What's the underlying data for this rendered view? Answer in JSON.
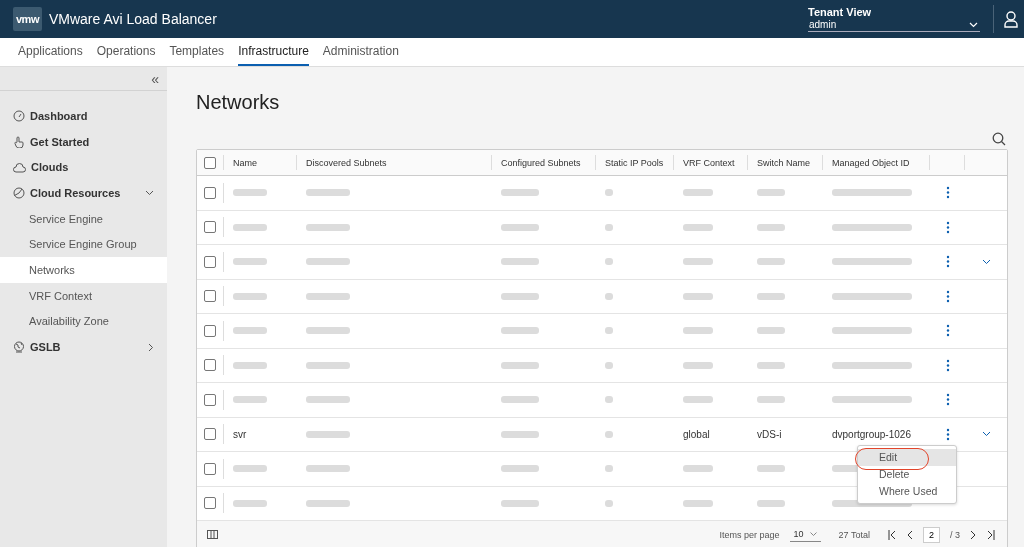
{
  "header": {
    "logo": "vmw",
    "title": "VMware Avi Load Balancer",
    "tenant_label": "Tenant View",
    "tenant_value": "admin"
  },
  "nav_tabs": [
    {
      "label": "Applications",
      "selected": false
    },
    {
      "label": "Operations",
      "selected": false
    },
    {
      "label": "Templates",
      "selected": false
    },
    {
      "label": "Infrastructure",
      "selected": true
    },
    {
      "label": "Administration",
      "selected": false
    }
  ],
  "sidebar": {
    "collapse": "«",
    "items": [
      {
        "label": "Dashboard",
        "selected": false
      },
      {
        "label": "Get Started",
        "selected": false
      },
      {
        "label": "Clouds",
        "selected": false
      },
      {
        "label": "Cloud Resources",
        "selected": false,
        "expanded": true,
        "children": [
          {
            "label": "Service Engine",
            "selected": false
          },
          {
            "label": "Service Engine Group",
            "selected": false
          },
          {
            "label": "Networks",
            "selected": true
          },
          {
            "label": "VRF Context",
            "selected": false
          },
          {
            "label": "Availability Zone",
            "selected": false
          }
        ]
      },
      {
        "label": "GSLB",
        "selected": false,
        "expanded": false
      }
    ]
  },
  "page_title": "Networks",
  "table": {
    "select_all_checked": false,
    "columns": [
      "Name",
      "Discovered Subnets",
      "Configured Subnets",
      "Static IP Pools",
      "VRF Context",
      "Switch Name",
      "Managed Object ID"
    ],
    "rows": [
      {
        "checked": false,
        "expandable": false,
        "cells": [
          {
            "kind": "redacted"
          },
          {
            "kind": "redacted"
          },
          {
            "kind": "redacted"
          },
          {
            "kind": "redacted"
          },
          {
            "kind": "redacted"
          },
          {
            "kind": "redacted"
          },
          {
            "kind": "redacted"
          }
        ]
      },
      {
        "checked": false,
        "expandable": false,
        "cells": [
          {
            "kind": "redacted"
          },
          {
            "kind": "redacted"
          },
          {
            "kind": "redacted"
          },
          {
            "kind": "redacted"
          },
          {
            "kind": "redacted"
          },
          {
            "kind": "redacted"
          },
          {
            "kind": "redacted"
          }
        ]
      },
      {
        "checked": false,
        "expandable": true,
        "cells": [
          {
            "kind": "redacted"
          },
          {
            "kind": "redacted"
          },
          {
            "kind": "redacted"
          },
          {
            "kind": "redacted"
          },
          {
            "kind": "redacted"
          },
          {
            "kind": "redacted"
          },
          {
            "kind": "redacted"
          }
        ]
      },
      {
        "checked": false,
        "expandable": false,
        "cells": [
          {
            "kind": "redacted"
          },
          {
            "kind": "redacted"
          },
          {
            "kind": "redacted"
          },
          {
            "kind": "redacted"
          },
          {
            "kind": "redacted"
          },
          {
            "kind": "redacted"
          },
          {
            "kind": "redacted"
          }
        ]
      },
      {
        "checked": false,
        "expandable": false,
        "cells": [
          {
            "kind": "redacted"
          },
          {
            "kind": "redacted"
          },
          {
            "kind": "redacted"
          },
          {
            "kind": "redacted"
          },
          {
            "kind": "redacted"
          },
          {
            "kind": "redacted"
          },
          {
            "kind": "redacted"
          }
        ]
      },
      {
        "checked": false,
        "expandable": false,
        "cells": [
          {
            "kind": "redacted"
          },
          {
            "kind": "redacted"
          },
          {
            "kind": "redacted"
          },
          {
            "kind": "redacted"
          },
          {
            "kind": "redacted"
          },
          {
            "kind": "redacted"
          },
          {
            "kind": "redacted"
          }
        ]
      },
      {
        "checked": false,
        "expandable": false,
        "cells": [
          {
            "kind": "redacted"
          },
          {
            "kind": "redacted"
          },
          {
            "kind": "redacted"
          },
          {
            "kind": "redacted"
          },
          {
            "kind": "redacted"
          },
          {
            "kind": "redacted"
          },
          {
            "kind": "redacted"
          }
        ]
      },
      {
        "checked": false,
        "expandable": true,
        "menu": [
          {
            "label": "Edit",
            "highlighted": true,
            "circled": true
          },
          {
            "label": "Delete",
            "highlighted": false,
            "circled": false
          },
          {
            "label": "Where Used",
            "highlighted": false,
            "circled": false
          }
        ],
        "cells": [
          {
            "kind": "text",
            "text": "svr"
          },
          {
            "kind": "redacted"
          },
          {
            "kind": "redacted"
          },
          {
            "kind": "redacted"
          },
          {
            "kind": "text",
            "text": "global"
          },
          {
            "kind": "text",
            "text": "vDS-i"
          },
          {
            "kind": "text",
            "text": "dvportgroup-1026"
          }
        ]
      },
      {
        "checked": false,
        "expandable": false,
        "cells": [
          {
            "kind": "redacted"
          },
          {
            "kind": "redacted"
          },
          {
            "kind": "redacted"
          },
          {
            "kind": "redacted"
          },
          {
            "kind": "redacted"
          },
          {
            "kind": "redacted"
          },
          {
            "kind": "redacted"
          }
        ]
      },
      {
        "checked": false,
        "expandable": false,
        "cells": [
          {
            "kind": "redacted"
          },
          {
            "kind": "redacted"
          },
          {
            "kind": "redacted"
          },
          {
            "kind": "redacted"
          },
          {
            "kind": "redacted"
          },
          {
            "kind": "redacted"
          },
          {
            "kind": "redacted"
          }
        ]
      }
    ],
    "footer": {
      "items_per_page_label": "Items per page",
      "items_per_page": "10",
      "total": "27 Total",
      "page": "2",
      "page_count": "/ 3"
    }
  }
}
